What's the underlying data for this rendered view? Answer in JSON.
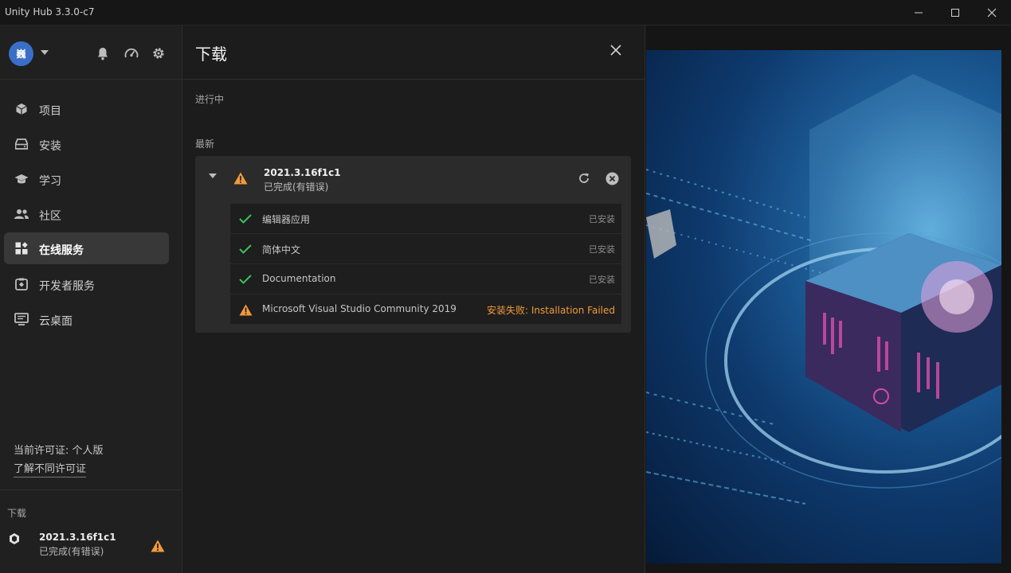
{
  "window": {
    "title": "Unity Hub 3.3.0-c7",
    "controls": [
      "minimize",
      "maximize",
      "close"
    ]
  },
  "sidebar": {
    "avatar_initial": "巍",
    "nav": [
      {
        "label": "项目",
        "icon": "cube-icon"
      },
      {
        "label": "安装",
        "icon": "drive-icon"
      },
      {
        "label": "学习",
        "icon": "graduation-cap-icon"
      },
      {
        "label": "社区",
        "icon": "people-icon"
      },
      {
        "label": "在线服务",
        "icon": "dashboard-icon",
        "active": true
      },
      {
        "label": "开发者服务",
        "icon": "dev-services-icon"
      },
      {
        "label": "云桌面",
        "icon": "monitor-icon"
      }
    ],
    "license_text": "当前许可证: 个人版",
    "license_link": "了解不同许可证",
    "downloads": {
      "header": "下载",
      "item_name": "2021.3.16f1c1",
      "item_status": "已完成(有错误)"
    }
  },
  "panel": {
    "title": "下载",
    "in_progress_label": "进行中",
    "recent_label": "最新",
    "card": {
      "name": "2021.3.16f1c1",
      "status": "已完成(有错误)",
      "items": [
        {
          "name": "编辑器应用",
          "status": "已安装",
          "state": "ok"
        },
        {
          "name": "简体中文",
          "status": "已安装",
          "state": "ok"
        },
        {
          "name": "Documentation",
          "status": "已安装",
          "state": "ok"
        },
        {
          "name": "Microsoft Visual Studio Community 2019",
          "status": "安装失败: Installation Failed",
          "state": "failed"
        }
      ]
    }
  },
  "colors": {
    "accent_success": "#3bc35a",
    "accent_warning": "#f29a3b",
    "active_nav_bg": "#383838",
    "avatar_bg": "#3a6fc7"
  }
}
